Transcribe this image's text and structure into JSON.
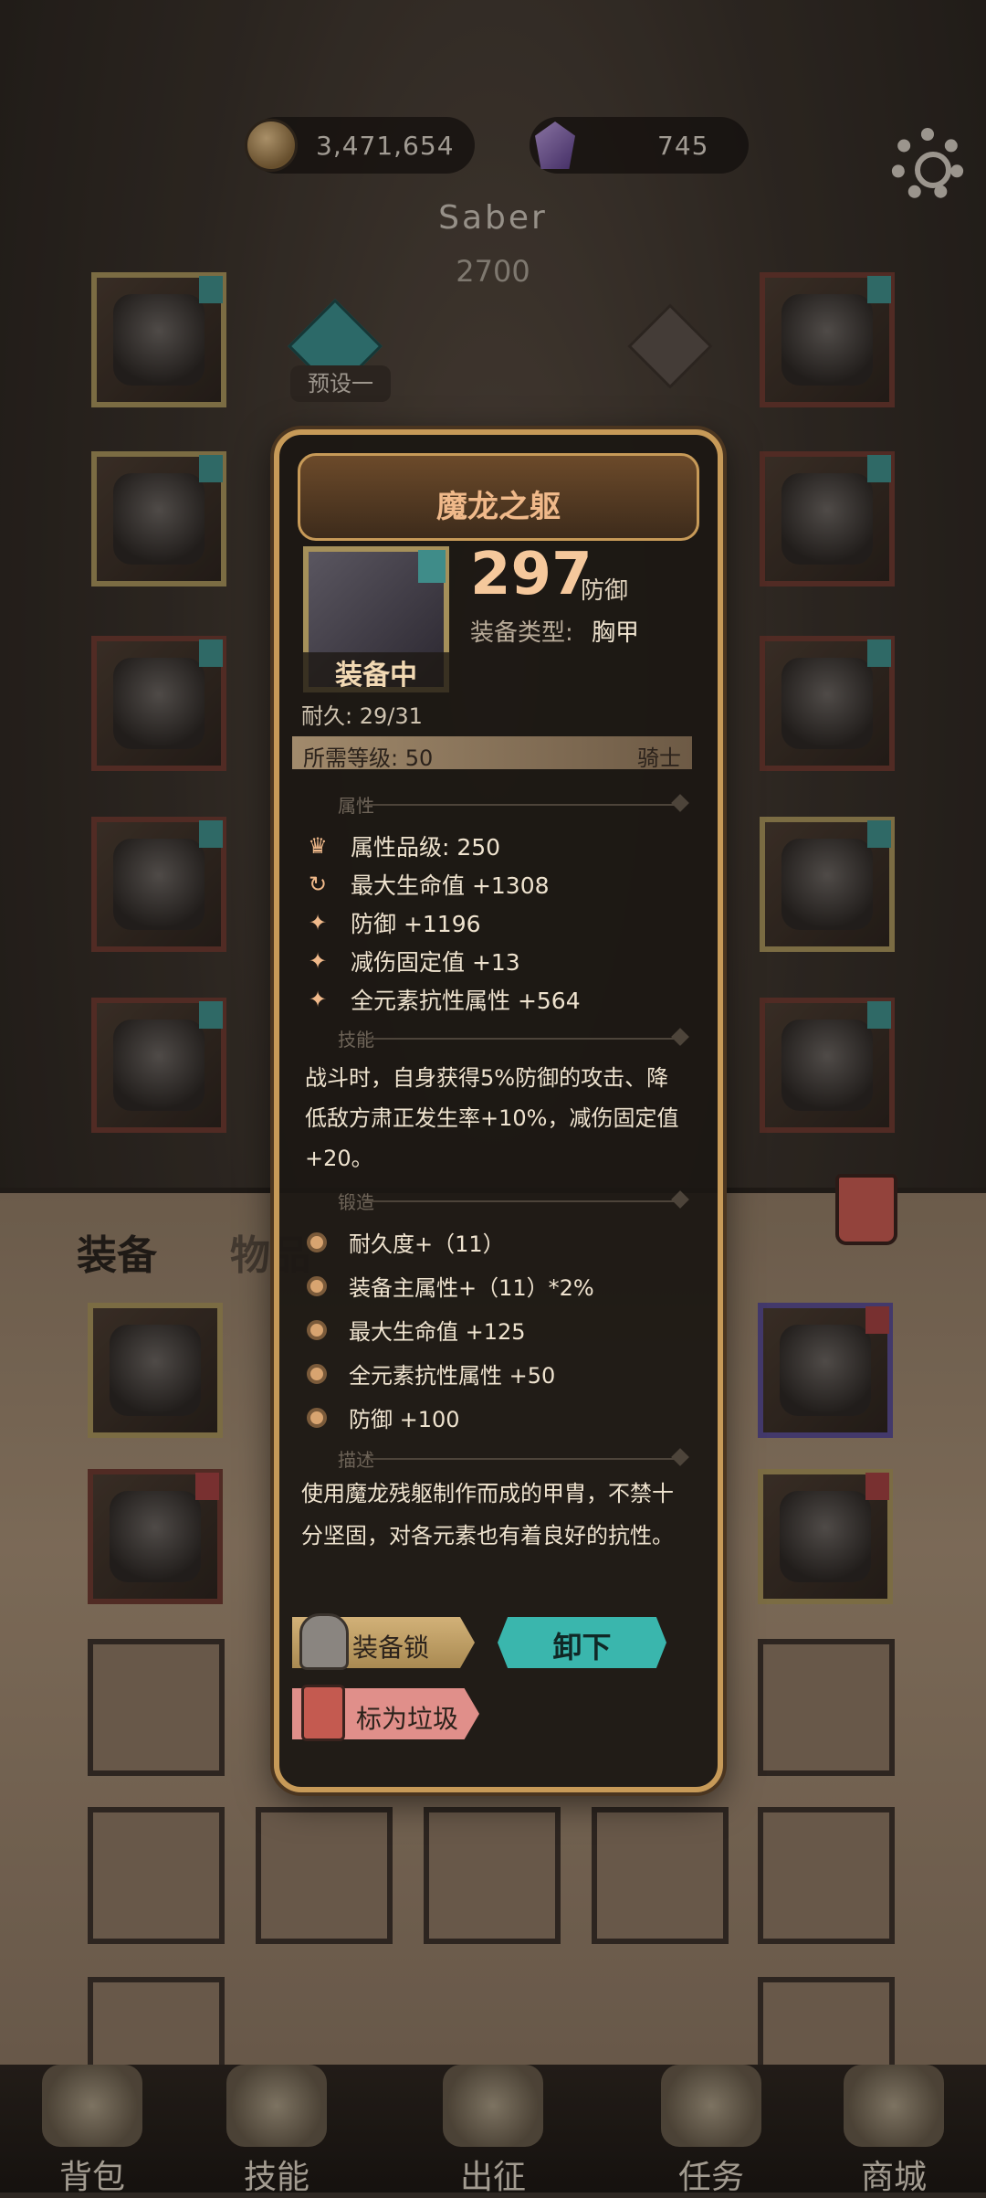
{
  "currency": {
    "gold": "3,471,654",
    "gems": "745"
  },
  "character": {
    "name": "Saber",
    "power": "2700",
    "preset_label": "预设一"
  },
  "tabs": {
    "equipment": "装备",
    "items": "物品"
  },
  "item": {
    "name": "魔龙之躯",
    "defense_value": "297",
    "defense_unit": "防御",
    "type_label": "装备类型:",
    "type_value": "胸甲",
    "equipped_label": "装备中",
    "durability": "耐久: 29/31",
    "required_level": "所需等级: 50",
    "class": "骑士",
    "section_attributes": "属性",
    "attributes": [
      "属性品级: 250",
      "最大生命值 +1308",
      "防御 +1196",
      "减伤固定值 +13",
      "全元素抗性属性 +564"
    ],
    "section_skill": "技能",
    "skill_text": "战斗时，自身获得5%防御的攻击、降低敌方肃正发生率+10%，减伤固定值+20。",
    "section_forge": "锻造",
    "forge": [
      "耐久度+（11）",
      "装备主属性+（11）*2%",
      "最大生命值 +125",
      "全元素抗性属性 +50",
      "防御 +100"
    ],
    "section_desc": "描述",
    "description": "使用魔龙残躯制作而成的甲胄，不禁十分坚固，对各元素也有着良好的抗性。",
    "buttons": {
      "lock": "装备锁",
      "unequip": "卸下",
      "mark_trash": "标为垃圾"
    }
  },
  "bottom_nav": [
    "背包",
    "技能",
    "出征",
    "任务",
    "商城"
  ],
  "colors": {
    "accent_gold": "#c79a58",
    "title_orange": "#f0b98a",
    "teal": "#3ab6ad",
    "pink": "#e08f8a"
  }
}
